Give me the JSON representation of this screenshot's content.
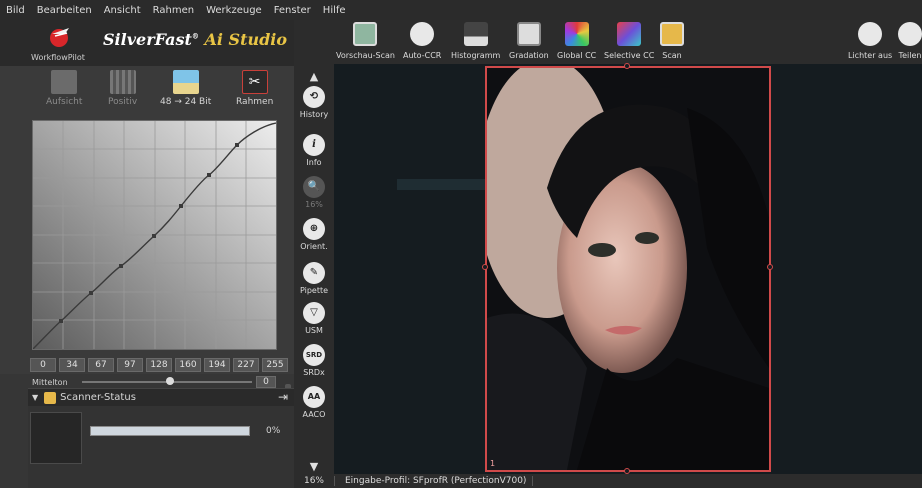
{
  "menu": [
    "Bild",
    "Bearbeiten",
    "Ansicht",
    "Rahmen",
    "Werkzeuge",
    "Fenster",
    "Hilfe"
  ],
  "brand": {
    "name": "SilverFast",
    "reg": "®",
    "ai": "Ai Studio",
    "workflow_label": "WorkflowPilot"
  },
  "left_tools": [
    {
      "label": "Aufsicht",
      "icon": "palm-icon",
      "enabled": false
    },
    {
      "label": "Positiv",
      "icon": "film-icon",
      "enabled": false
    },
    {
      "label": "48 → 24 Bit",
      "icon": "beach-icon",
      "enabled": true
    },
    {
      "label": "Rahmen",
      "icon": "scissors-icon",
      "enabled": true
    }
  ],
  "gradation": {
    "tick_values": [
      "0",
      "34",
      "67",
      "97",
      "128",
      "160",
      "194",
      "227",
      "255"
    ],
    "midtone_label": "Mittelton",
    "midtone_value": "0"
  },
  "scanner_status": {
    "title": "Scanner-Status",
    "progress": 0,
    "percent_label": "0%"
  },
  "vtools": [
    {
      "label": "History",
      "glyph": "⟲",
      "enabled": true
    },
    {
      "label": "Info",
      "glyph": "i",
      "enabled": true
    },
    {
      "label": "16%",
      "glyph": "🔍",
      "enabled": false
    },
    {
      "label": "Orient.",
      "glyph": "⊕",
      "enabled": true
    },
    {
      "label": "Pipette",
      "glyph": "✎",
      "enabled": true
    },
    {
      "label": "USM",
      "glyph": "▽",
      "enabled": true
    },
    {
      "label": "SRDx",
      "glyph": "SRD",
      "enabled": true
    },
    {
      "label": "AACO",
      "glyph": "AA",
      "enabled": true
    }
  ],
  "toolbar": [
    {
      "label": "Vorschau-Scan",
      "icon": "prescan-icon",
      "color": "#8fb6a0"
    },
    {
      "label": "Auto-CCR",
      "icon": "auto-ccr-icon",
      "color": "#d8d8d8"
    },
    {
      "label": "Histogramm",
      "icon": "histogram-icon",
      "color": "#d8d8d8"
    },
    {
      "label": "Gradation",
      "icon": "gradation-icon",
      "color": "#d8d8d8"
    },
    {
      "label": "Global CC",
      "icon": "global-cc-icon",
      "color": "#e05a3a"
    },
    {
      "label": "Selective CC",
      "icon": "selective-cc-icon",
      "color": "#6d4fd8"
    },
    {
      "label": "Scan",
      "icon": "scan-icon",
      "color": "#e6b84a"
    },
    {
      "label": "Lichter aus",
      "icon": "lights-off-icon",
      "color": "#e8e8e8"
    },
    {
      "label": "Teilen",
      "icon": "share-icon",
      "color": "#e8e8e8"
    }
  ],
  "frame": {
    "number": "1"
  },
  "status_bar": {
    "zoom": "16%",
    "profile": "Eingabe-Profil: SFprofR (PerfectionV700)"
  }
}
